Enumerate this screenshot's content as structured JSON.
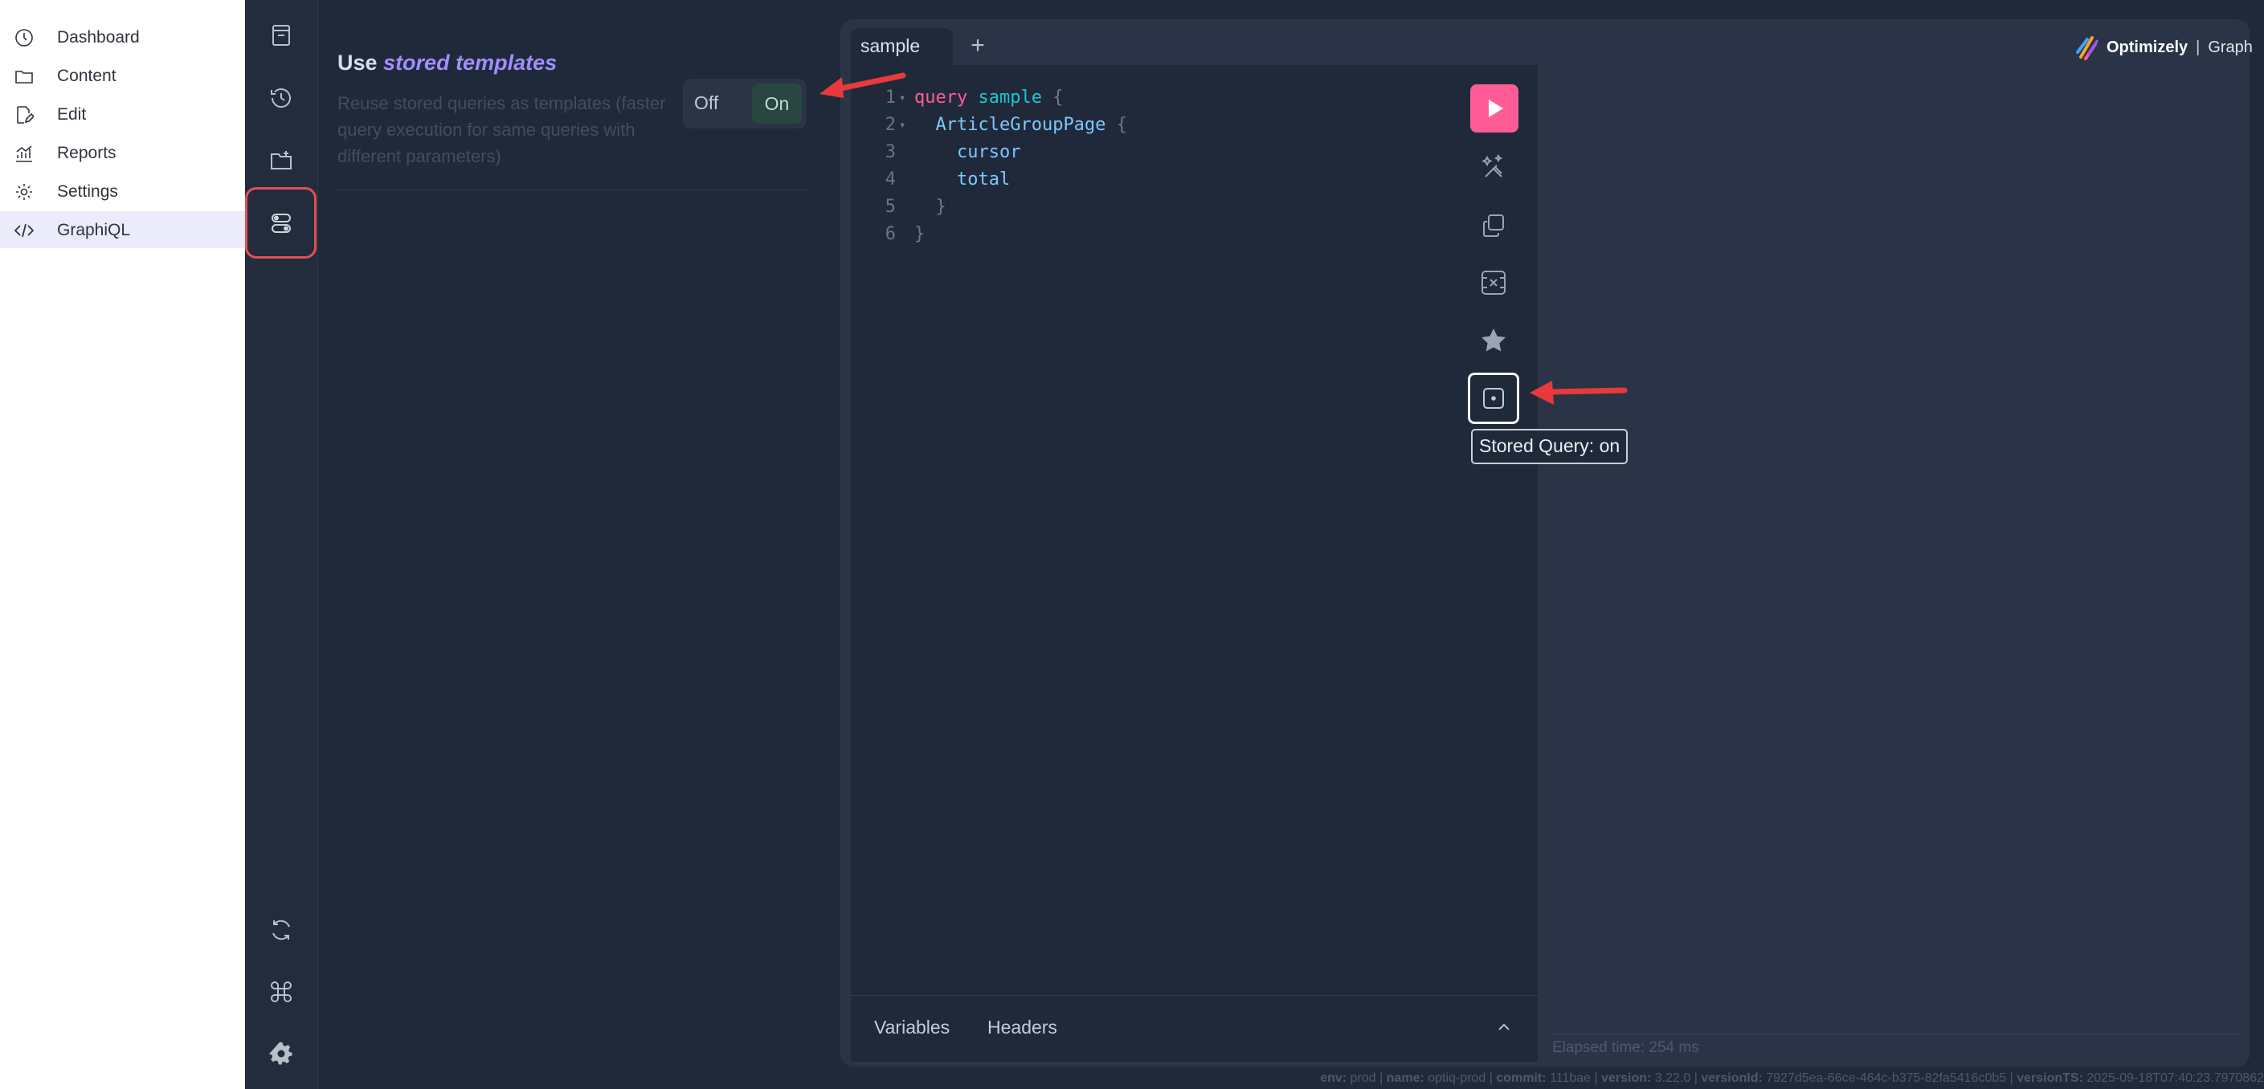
{
  "nav": {
    "items": [
      {
        "label": "Dashboard",
        "icon": "dashboard-icon"
      },
      {
        "label": "Content",
        "icon": "folder-icon"
      },
      {
        "label": "Edit",
        "icon": "edit-icon"
      },
      {
        "label": "Reports",
        "icon": "chart-icon"
      },
      {
        "label": "Settings",
        "icon": "gear-icon"
      },
      {
        "label": "GraphiQL",
        "icon": "code-icon",
        "active": true
      }
    ]
  },
  "sidebar": {
    "icons": [
      "docs-icon",
      "history-icon",
      "collections-icon",
      "settings-toggle-icon",
      "refresh-icon",
      "command-icon",
      "gear-icon"
    ]
  },
  "settings": {
    "title_prefix": "Use ",
    "title_emphasis": "stored templates",
    "description": "Reuse stored queries as templates (faster query execution for same queries with different parameters)",
    "toggle_off": "Off",
    "toggle_on": "On",
    "toggle_value": "On"
  },
  "editor": {
    "tab_label": "sample",
    "add_tab": "+",
    "lines": [
      {
        "n": "1",
        "fold": true,
        "indent": "",
        "tokens": [
          [
            "kw",
            "query"
          ],
          [
            "sp",
            " "
          ],
          [
            "qn",
            "sample"
          ],
          [
            "sp",
            " "
          ],
          [
            "brace",
            "{"
          ]
        ]
      },
      {
        "n": "2",
        "fold": true,
        "indent": "  ",
        "tokens": [
          [
            "fld",
            "ArticleGroupPage"
          ],
          [
            "sp",
            " "
          ],
          [
            "brace",
            "{"
          ]
        ]
      },
      {
        "n": "3",
        "fold": false,
        "indent": "    ",
        "tokens": [
          [
            "fld",
            "cursor"
          ]
        ]
      },
      {
        "n": "4",
        "fold": false,
        "indent": "    ",
        "tokens": [
          [
            "fld",
            "total"
          ]
        ]
      },
      {
        "n": "5",
        "fold": false,
        "indent": "  ",
        "tokens": [
          [
            "brace",
            "}"
          ]
        ]
      },
      {
        "n": "6",
        "fold": false,
        "indent": "",
        "tokens": [
          [
            "brace",
            "}"
          ]
        ]
      }
    ],
    "tooltip": "Stored Query: on",
    "variables_tab": "Variables",
    "headers_tab": "Headers"
  },
  "brand": {
    "logo_text": "Optimizely",
    "separator": "|",
    "product": "Graph"
  },
  "results": {
    "elapsed": "Elapsed time: 254 ms"
  },
  "footer": {
    "env_label": "env:",
    "env": "prod",
    "name_label": "name:",
    "name": "optiq-prod",
    "commit_label": "commit:",
    "commit": "111bae",
    "version_label": "version:",
    "version": "3.22.0",
    "version_id_label": "versionId:",
    "version_id": "7927d5ea-66ce-464c-b375-82fa5416c0b5",
    "version_ts_label": "versionTS:",
    "version_ts": "2025-09-18T07:40:23.7970862"
  },
  "colors": {
    "accent": "#ff5c95",
    "annotation": "#e83a3a",
    "emphasis": "#9f8fff"
  }
}
